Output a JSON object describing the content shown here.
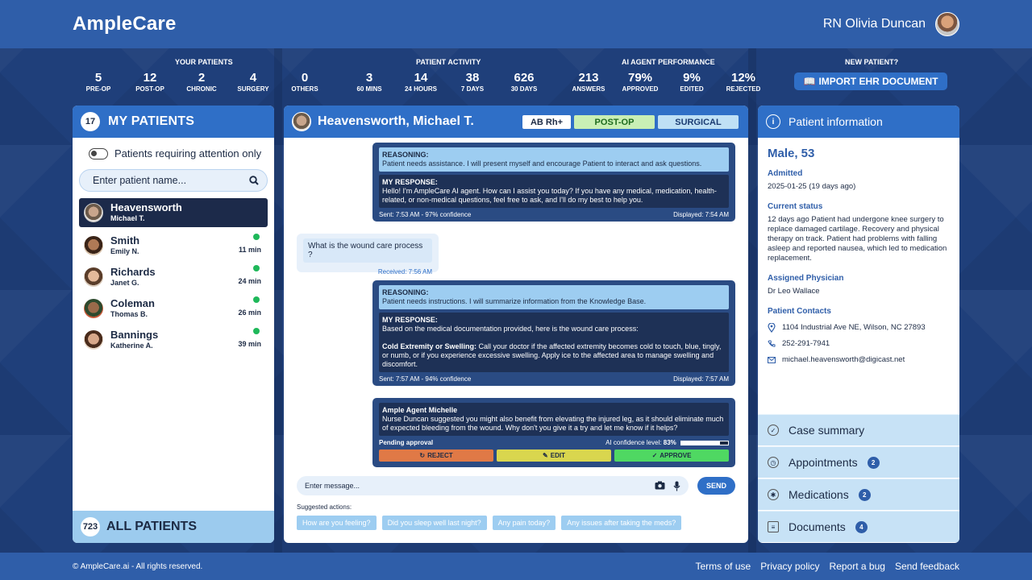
{
  "app": {
    "brand": "AmpleCare",
    "user_name": "RN Olivia Duncan"
  },
  "stats": {
    "your_patients": {
      "title": "YOUR PATIENTS",
      "items": [
        {
          "num": "5",
          "label": "PRE-OP"
        },
        {
          "num": "12",
          "label": "POST-OP"
        },
        {
          "num": "2",
          "label": "CHRONIC"
        },
        {
          "num": "4",
          "label": "SURGERY"
        },
        {
          "num": "0",
          "label": "OTHERS"
        }
      ]
    },
    "patient_activity": {
      "title": "PATIENT ACTIVITY",
      "items": [
        {
          "num": "3",
          "label": "60 MINS"
        },
        {
          "num": "14",
          "label": "24 HOURS"
        },
        {
          "num": "38",
          "label": "7 DAYS"
        },
        {
          "num": "626",
          "label": "30 DAYS"
        }
      ]
    },
    "ai_agent": {
      "title": "AI AGENT PERFORMANCE",
      "items": [
        {
          "num": "213",
          "label": "ANSWERS"
        },
        {
          "num": "79%",
          "label": "APPROVED"
        },
        {
          "num": "9%",
          "label": "EDITED"
        },
        {
          "num": "12%",
          "label": "REJECTED"
        }
      ]
    },
    "new_patient": {
      "title": "NEW PATIENT?",
      "button": "IMPORT EHR DOCUMENT"
    }
  },
  "left": {
    "count": "17",
    "title": "MY PATIENTS",
    "toggle_label": "Patients requiring attention only",
    "search_placeholder": "Enter patient name...",
    "patients": [
      {
        "name": "Heavensworth",
        "sub": "Michael T.",
        "time": ""
      },
      {
        "name": "Smith",
        "sub": "Emily N.",
        "time": "11 min"
      },
      {
        "name": "Richards",
        "sub": "Janet G.",
        "time": "24 min"
      },
      {
        "name": "Coleman",
        "sub": "Thomas B.",
        "time": "26 min"
      },
      {
        "name": "Bannings",
        "sub": "Katherine A.",
        "time": "39 min"
      }
    ],
    "all_count": "723",
    "all_title": "ALL PATIENTS"
  },
  "chat": {
    "patient": "Heavensworth, Michael T.",
    "tags": {
      "blood": "AB Rh+",
      "phase": "POST-OP",
      "type": "SURGICAL"
    },
    "m1": {
      "reason_label": "REASONING:",
      "reason": "Patient needs assistance. I will present myself and encourage Patient to interact and ask questions.",
      "resp_label": "MY RESPONSE:",
      "resp": "Hello! I'm AmpleCare AI agent. How can I assist you today? If you have  any medical, medication, health-related, or non-medical questions, feel  free to ask, and I'll do my best to help you.",
      "sent": "Sent: 7:53 AM - 97% confidence",
      "displayed": "Displayed: 7:54 AM"
    },
    "m2": {
      "question": "What is the wound care process ?",
      "received": "Received: 7:56 AM"
    },
    "m3": {
      "reason_label": "REASONING:",
      "reason": "Patient needs instructions. I will summarize information from the Knowledge Base.",
      "resp_label": "MY RESPONSE:",
      "resp": "Based on the medical documentation provided, here is the wound care  process:",
      "resp_bold": "Cold Extremity or Swelling:",
      "resp2": " Call your doctor if the affected extremity becomes cold to touch, blue, tingly, or numb, or if you  experience excessive swelling. Apply ice to the affected area to manage swelling and discomfort.",
      "sent": "Sent: 7:57 AM - 94% confidence",
      "displayed": "Displayed: 7:57 AM"
    },
    "m4": {
      "agent": "Ample Agent Michelle",
      "text": "Nurse Duncan suggested you might also benefit from elevating the injured leg, as it should eliminate much of expected bleeding from the wound. Why don't you give it a try and let me know if it helps?",
      "pending": "Pending approval",
      "conf_label": "AI confidence level:",
      "conf_value": "83%",
      "conf_fraction": 0.83,
      "reject": "REJECT",
      "edit": "EDIT",
      "approve": "APPROVE"
    },
    "composer_placeholder": "Enter message...",
    "send": "SEND",
    "suggested_label": "Suggested actions:",
    "suggestions": [
      "How are you feeling?",
      "Did you sleep well last night?",
      "Any pain today?",
      "Any issues after taking the meds?"
    ]
  },
  "info": {
    "title": "Patient information",
    "sex_age": "Male, 53",
    "admitted_label": "Admitted",
    "admitted": "2025-01-25 (19 days ago)",
    "status_label": "Current status",
    "status": "12 days ago Patient had undergone knee surgery to replace damaged cartilage. Recovery and physical therapy on track. Patient had problems with falling asleep and reported nausea, which led to medication replacement.",
    "physician_label": "Assigned Physician",
    "physician": "Dr Leo Wallace",
    "contacts_label": "Patient Contacts",
    "address": "1104 Industrial Ave NE, Wilson, NC 27893",
    "phone": "252-291-7941",
    "email": "michael.heavensworth@digicast.net",
    "sections": [
      {
        "label": "Case summary",
        "count": ""
      },
      {
        "label": "Appointments",
        "count": "2"
      },
      {
        "label": "Medications",
        "count": "2"
      },
      {
        "label": "Documents",
        "count": "4"
      }
    ]
  },
  "footer": {
    "copyright": "© AmpleCare.ai - All rights reserved.",
    "links": [
      "Terms of use",
      "Privacy policy",
      "Report a bug",
      "Send feedback"
    ]
  }
}
